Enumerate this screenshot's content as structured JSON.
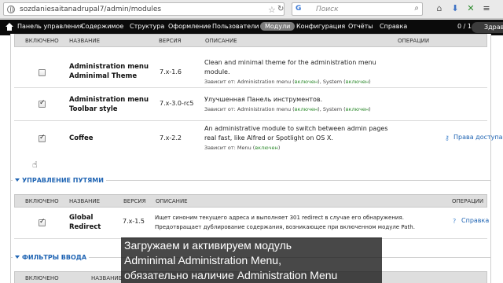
{
  "browser": {
    "url": "sozdaniesaitanadrupal7/admin/modules",
    "search_engine_icon": "G",
    "search_placeholder": "Поиск"
  },
  "toolbar": {
    "items": [
      {
        "label": "Панель управления"
      },
      {
        "label": "Содержимое"
      },
      {
        "label": "Структура"
      },
      {
        "label": "Оформление"
      },
      {
        "label": "Пользователи"
      },
      {
        "label": "Модули",
        "active": true
      },
      {
        "label": "Конфигурация"
      },
      {
        "label": "Отчёты"
      },
      {
        "label": "Справка"
      }
    ],
    "counter": "0 / 1",
    "user_label": "Здрав"
  },
  "section1": {
    "headers": {
      "enabled": "ВКЛЮЧЕНО",
      "name": "НАЗВАНИЕ",
      "version": "ВЕРСИЯ",
      "description": "ОПИСАНИЕ",
      "operations": "ОПЕРАЦИИ"
    },
    "rows": [
      {
        "enabled": false,
        "name_line1": "Administration menu",
        "name_line2": "Adminimal Theme",
        "version": "7.x-1.6",
        "desc_line1": "Clean and minimal theme for the administration menu",
        "desc_line2": "module.",
        "req_prefix": "Зависит от: Administration menu (",
        "req_ok1": "включен",
        "req_mid": "), System (",
        "req_ok2": "включен",
        "req_suffix": ")",
        "operation": ""
      },
      {
        "enabled": true,
        "name_line1": "Administration menu",
        "name_line2": "Toolbar style",
        "version": "7.x-3.0-rc5",
        "desc_line1": "Улучшенная Панель инструментов.",
        "desc_line2": "",
        "req_prefix": "Зависит от: Administration menu (",
        "req_ok1": "включен",
        "req_mid": "), System (",
        "req_ok2": "включен",
        "req_suffix": ")",
        "operation": ""
      },
      {
        "enabled": true,
        "name_line1": "Coffee",
        "name_line2": "",
        "version": "7.x-2.2",
        "desc_line1": "An administrative module to switch between admin pages",
        "desc_line2": "real fast, like Alfred or Spotlight on OS X.",
        "req_prefix": "Зависит от: Menu (",
        "req_ok1": "включен",
        "req_mid": ")",
        "req_ok2": "",
        "req_suffix": "",
        "operation": "Права доступа"
      }
    ]
  },
  "section2": {
    "legend": "УПРАВЛЕНИЕ ПУТЯМИ",
    "headers": {
      "enabled": "ВКЛЮЧЕНО",
      "name": "НАЗВАНИЕ",
      "version": "ВЕРСИЯ",
      "description": "ОПИСАНИЕ",
      "operations": "ОПЕРАЦИИ"
    },
    "rows": [
      {
        "enabled": true,
        "name_line1": "Global",
        "name_line2": "Redirect",
        "version": "7.x-1.5",
        "desc_line1": "Ищет синоним текущего адреса и выполняет 301 redirect в случае его обнаружения.",
        "desc_line2": "Предотвращает дублирование содержания, возникающее при включенном модуле Path.",
        "operation": "Справка"
      }
    ]
  },
  "section3": {
    "legend": "ФИЛЬТРЫ ВВОДА",
    "headers": {
      "enabled": "ВКЛЮЧЕНО",
      "name": "НАЗВАНИЕ"
    }
  },
  "subtitle": {
    "line1": "Загружаем и активируем модуль",
    "line2": "Adminimal Administration Menu,",
    "line3": "обязательно наличие Administration Menu"
  }
}
